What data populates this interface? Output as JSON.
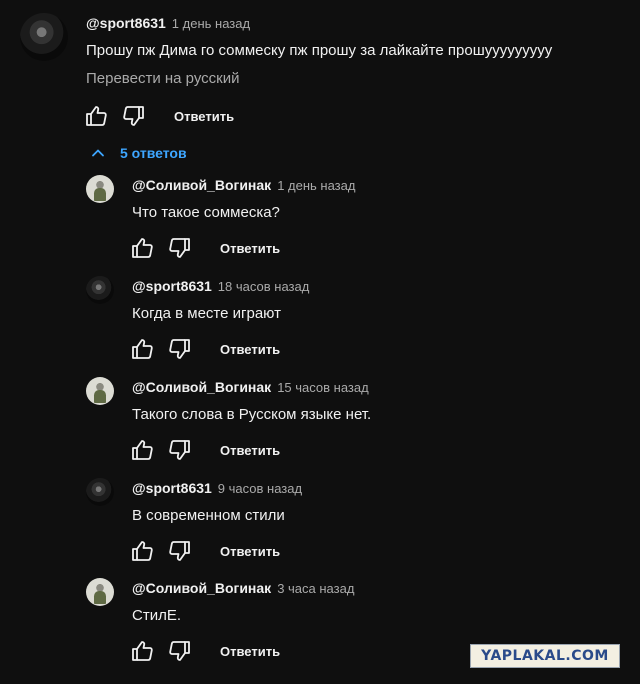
{
  "top_comment": {
    "author": "@sport8631",
    "time": "1 день назад",
    "text": "Прошу пж Дима го соммеску пж прошу за лайкайте прошууууууууу",
    "translate_label": "Перевести на русский",
    "reply_label": "Ответить"
  },
  "replies_toggle": {
    "label": "5 ответов"
  },
  "replies": [
    {
      "author": "@Соливой_Вогинак",
      "time": "1 день назад",
      "text": "Что такое соммеска?",
      "reply_label": "Ответить",
      "avatar": "voginak"
    },
    {
      "author": "@sport8631",
      "time": "18 часов назад",
      "text": "Когда в месте играют",
      "reply_label": "Ответить",
      "avatar": "sport"
    },
    {
      "author": "@Соливой_Вогинак",
      "time": "15 часов назад",
      "text": "Такого слова в Русском языке нет.",
      "reply_label": "Ответить",
      "avatar": "voginak"
    },
    {
      "author": "@sport8631",
      "time": "9 часов назад",
      "text": "В современном стили",
      "reply_label": "Ответить",
      "avatar": "sport"
    },
    {
      "author": "@Соливой_Вогинак",
      "time": "3 часа назад",
      "text": "СтилЕ.",
      "reply_label": "Ответить",
      "avatar": "voginak"
    }
  ],
  "watermark": "YAPLAKAL.COM",
  "colors": {
    "background": "#0f0f0f",
    "link_blue": "#3ea6ff",
    "secondary_text": "#aaaaaa"
  }
}
